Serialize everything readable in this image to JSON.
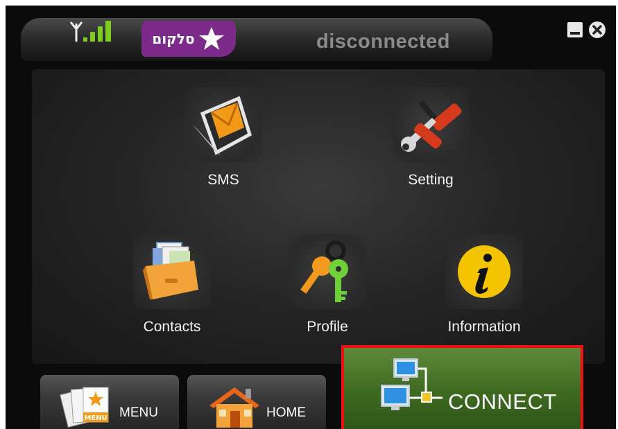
{
  "header": {
    "brand_text": "סלקום",
    "status": "disconnected",
    "signal_bars": 4
  },
  "window_controls": {
    "minimize_icon": "minimize-icon",
    "close_icon": "close-icon"
  },
  "tiles": [
    {
      "id": "sms",
      "label": "SMS",
      "icon": "envelope-folder-icon"
    },
    {
      "id": "setting",
      "label": "Setting",
      "icon": "tools-icon"
    },
    {
      "id": "contacts",
      "label": "Contacts",
      "icon": "card-box-icon"
    },
    {
      "id": "profile",
      "label": "Profile",
      "icon": "keys-icon"
    },
    {
      "id": "information",
      "label": "Information",
      "icon": "info-icon"
    }
  ],
  "bottom": {
    "menu_label": "MENU",
    "home_label": "HOME",
    "connect_label": "CONNECT",
    "menu_badge": "MENU"
  },
  "colors": {
    "brand_purple": "#7d2b8a",
    "signal_green": "#7dcc1f",
    "connect_green": "#4a7a2a",
    "connect_border": "#ee1111",
    "info_yellow": "#f5c400"
  }
}
